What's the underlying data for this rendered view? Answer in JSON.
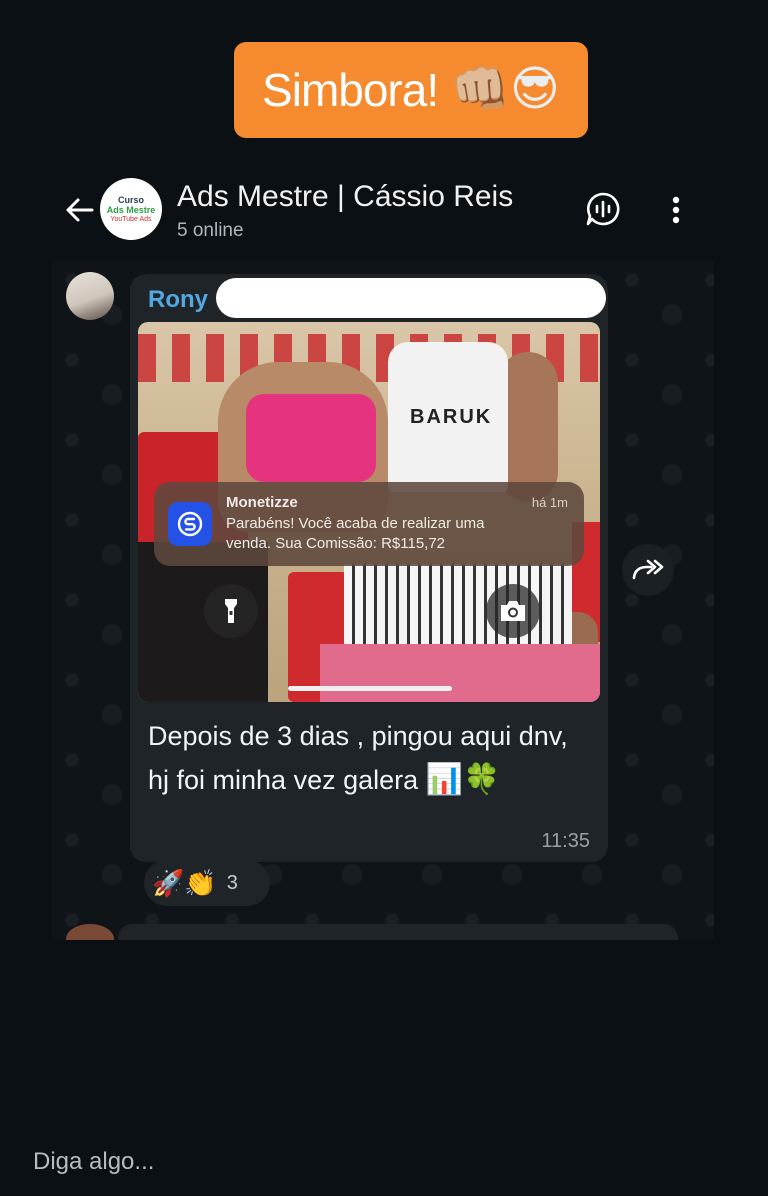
{
  "story": {
    "sticker_text": "Simbora!",
    "sticker_emojis": "👊🏼😎"
  },
  "header": {
    "title": "Ads Mestre | Cássio Reis",
    "status": "5 online",
    "avatar": {
      "line1": "Curso",
      "line2": "Ads Mestre",
      "line3": "YouTube Ads"
    }
  },
  "message": {
    "sender": "Rony",
    "caption_text": "Depois de 3 dias , pingou aqui dnv, hj foi minha vez galera",
    "caption_emojis": "📊🍀",
    "time": "11:35",
    "photo": {
      "tank_print": "BARUK",
      "notification": {
        "app": "Monetizze",
        "time": "há 1m",
        "body": "Parabéns! Você acaba de realizar uma venda. Sua Comissão: R$115,72"
      }
    },
    "reactions": {
      "emojis": "🚀👏",
      "count": "3"
    }
  },
  "composer": {
    "placeholder": "Diga algo..."
  },
  "colors": {
    "background": "#0b1015",
    "sticker": "#f58a2e",
    "bubble": "#1f2428",
    "sender_name": "#53a8e2",
    "notification_icon": "#2451e6"
  },
  "icons": [
    "back-arrow-icon",
    "voice-chat-icon",
    "more-vertical-icon",
    "flashlight-icon",
    "camera-icon",
    "forward-icon",
    "monetizze-logo-icon"
  ]
}
